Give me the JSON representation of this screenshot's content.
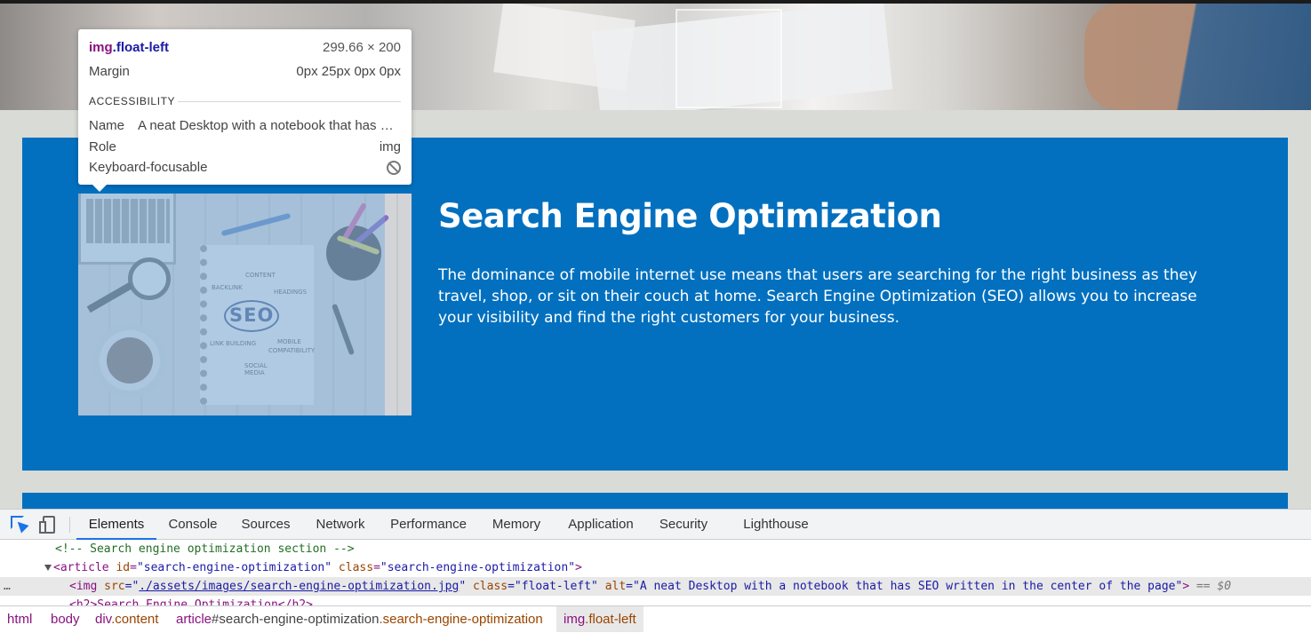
{
  "tooltip": {
    "selector_tag": "img",
    "selector_class": ".float-left",
    "size": "299.66 × 200",
    "margin_label": "Margin",
    "margin_value": "0px 25px 0px 0px",
    "accessibility_label": "ACCESSIBILITY",
    "name_label": "Name",
    "name_value": "A neat Desktop with a notebook that has SEO written in the center of the page",
    "role_label": "Role",
    "role_value": "img",
    "keyboard_label": "Keyboard-focusable",
    "keyboard_icon": "not-allowed-icon"
  },
  "section": {
    "title": "Search Engine Optimization",
    "text": "The dominance of mobile internet use means that users are searching for the right business as they travel, shop, or sit on their couch at home. Search Engine Optimization (SEO) allows you to increase your visibility and find the right customers for your business.",
    "image_labels": {
      "center": "SEO",
      "backlink": "BACKLINK",
      "content": "CONTENT",
      "headings": "HEADINGS",
      "link_building": "LINK BUILDING",
      "mobile": "MOBILE",
      "compatibility": "COMPATIBILITY",
      "social": "SOCIAL",
      "media": "MEDIA"
    }
  },
  "colors": {
    "section_bg": "#0270bf",
    "page_bg": "#d9dbd6",
    "accent": "#1a73e8"
  },
  "devtools": {
    "tabs": [
      "Elements",
      "Console",
      "Sources",
      "Network",
      "Performance",
      "Memory",
      "Application",
      "Security",
      "Lighthouse"
    ],
    "active_tab": "Elements",
    "dom": {
      "comment": "<!-- Search engine optimization section -->",
      "article_open_tag": "<article",
      "article_id_attr": "id",
      "article_id_val": "\"search-engine-optimization\"",
      "article_class_attr": "class",
      "article_class_val": "\"search-engine-optimization\"",
      "article_close": ">",
      "img_tag": "<img",
      "img_src_attr": "src",
      "img_src_quote_open": "=\"",
      "img_src_val": "./assets/images/search-engine-optimization.jpg",
      "img_src_quote_close": "\"",
      "img_class_attr": "class",
      "img_class_val": "=\"float-left\"",
      "img_alt_attr": "alt",
      "img_alt_val": "=\"A neat Desktop with a notebook that has SEO written in the center of the page\"",
      "img_close": ">",
      "img_eq": "== $0",
      "h2_partial": "<h2>Search Engine Optimization</h2>",
      "dots": "…"
    },
    "breadcrumbs": [
      {
        "tag": "html",
        "id": "",
        "cls": ""
      },
      {
        "tag": "body",
        "id": "",
        "cls": ""
      },
      {
        "tag": "div",
        "id": "",
        "cls": ".content"
      },
      {
        "tag": "article",
        "id": "#search-engine-optimization",
        "cls": ".search-engine-optimization"
      },
      {
        "tag": "img",
        "id": "",
        "cls": ".float-left"
      }
    ]
  }
}
